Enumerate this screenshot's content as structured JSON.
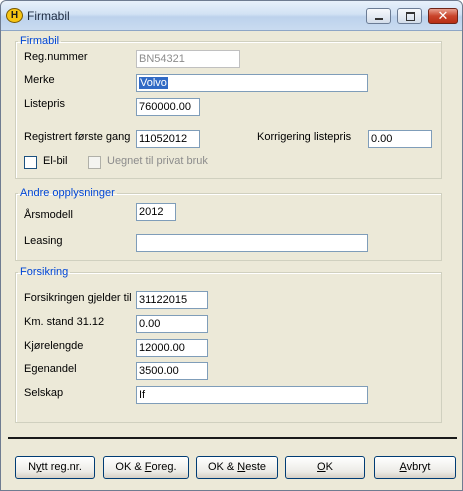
{
  "window": {
    "app_icon_letter": "H",
    "title": "Firmabil",
    "close_glyph": "✕"
  },
  "firmabil": {
    "legend": "Firmabil",
    "reg_label": "Reg.nummer",
    "reg_value": "BN54321",
    "merke_label": "Merke",
    "merke_value": "Volvo",
    "listepris_label": "Listepris",
    "listepris_value": "760000.00",
    "reg_first_label": "Registrert første gang",
    "reg_first_value": "11052012",
    "korr_label": "Korrigering listepris",
    "korr_value": "0.00",
    "elbil_label": "El-bil",
    "elbil_checked": false,
    "uegnet_label": "Uegnet til privat bruk",
    "uegnet_checked": false
  },
  "andre": {
    "legend": "Andre opplysninger",
    "arsmodell_label": "Årsmodell",
    "arsmodell_value": "2012",
    "leasing_label": "Leasing",
    "leasing_value": ""
  },
  "forsikring": {
    "legend": "Forsikring",
    "gjelder_label": "Forsikringen gjelder til",
    "gjelder_value": "31122015",
    "km_label": "Km. stand 31.12",
    "km_value": "0.00",
    "kjorelengde_label": "Kjørelengde",
    "kjorelengde_value": "12000.00",
    "egenandel_label": "Egenandel",
    "egenandel_value": "3500.00",
    "selskap_label": "Selskap",
    "selskap_value": "If"
  },
  "buttons": {
    "nytt_pre": "N",
    "nytt_ul": "y",
    "nytt_post": "tt reg.nr.",
    "okforeg_pre": "OK & ",
    "okforeg_ul": "F",
    "okforeg_post": "oreg.",
    "okneste_pre": "OK & ",
    "okneste_ul": "N",
    "okneste_post": "este",
    "ok_ul": "O",
    "ok_post": "K",
    "avbryt_ul": "A",
    "avbryt_post": "vbryt"
  }
}
